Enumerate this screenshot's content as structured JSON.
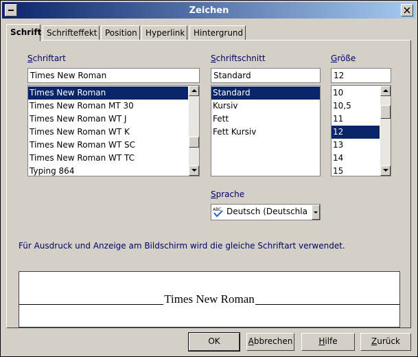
{
  "window": {
    "title": "Zeichen"
  },
  "tabs": [
    {
      "label": "Schrift"
    },
    {
      "label": "Schrifteffekt"
    },
    {
      "label": "Position"
    },
    {
      "label": "Hyperlink"
    },
    {
      "label": "Hintergrund"
    }
  ],
  "font": {
    "label_first": "S",
    "label_rest": "chriftart",
    "value": "Times New Roman",
    "items": [
      "Times New Roman",
      "Times New Roman MT 30",
      "Times New Roman WT J",
      "Times New Roman WT K",
      "Times New Roman WT SC",
      "Times New Roman WT TC",
      "Typing 864"
    ],
    "selected_index": 0
  },
  "style": {
    "label_first": "S",
    "label_rest": "chriftschnitt",
    "value": "Standard",
    "items": [
      "Standard",
      "Kursiv",
      "Fett",
      "Fett Kursiv"
    ],
    "selected_index": 0
  },
  "size": {
    "label_first": "G",
    "label_rest": "röße",
    "value": "12",
    "items": [
      "10",
      "10,5",
      "11",
      "12",
      "13",
      "14",
      "15"
    ],
    "selected_index": 3
  },
  "language": {
    "label_first": "S",
    "label_rest": "prache",
    "value": "Deutsch (Deutschland)",
    "icon": "spellcheck-icon"
  },
  "info_text": "Für Ausdruck und Anzeige am Bildschirm wird die gleiche Schriftart verwendet.",
  "preview_text": "Times New Roman",
  "buttons": {
    "ok": "OK",
    "cancel": "Abbrechen",
    "help": "Hilfe",
    "reset": "Zurück"
  },
  "colors": {
    "selection": "#0a246a",
    "label": "#00006b"
  }
}
